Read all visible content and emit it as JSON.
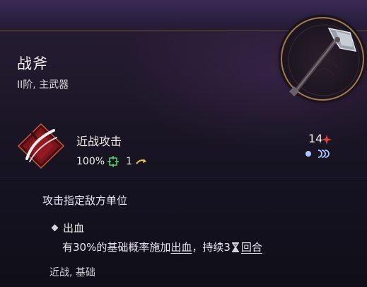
{
  "item": {
    "name": "战斧",
    "subtitle": "II阶, 主武器"
  },
  "skill": {
    "name": "近战攻击",
    "accuracy": "100%",
    "range_value": "1",
    "cost_value": "14",
    "description": "攻击指定敌方单位",
    "effect": {
      "title": "出血",
      "text_before": "有30%的基础概率施加",
      "link_status": "出血",
      "text_middle": "，持续3",
      "link_duration": "回合"
    },
    "tags": "近战, 基础"
  },
  "icons": {
    "portrait": "battle-axe-icon",
    "skill": "slash-attack-icon",
    "accuracy": "target-reticle-icon",
    "range": "curved-arrow-icon",
    "cost": "red-star-icon",
    "cooldown": "moon-phase-icon",
    "duration": "hourglass-icon"
  },
  "colors": {
    "accuracy_icon": "#5fd36a",
    "range_icon": "#e6c15a",
    "cost_icon": "#e0403a",
    "cooldown_icon": "#a8c8ff",
    "frame_gold": "#a07a52"
  }
}
